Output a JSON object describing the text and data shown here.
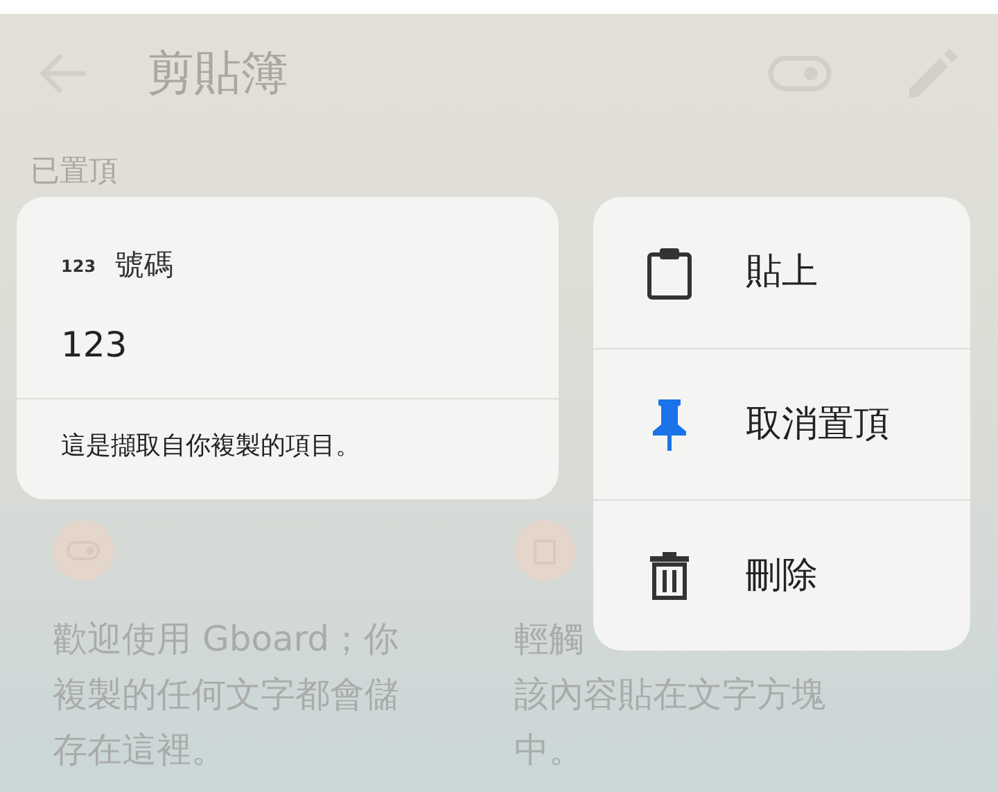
{
  "header": {
    "title": "剪貼簿"
  },
  "pinned_label": "已置頂",
  "tips": [
    {
      "kind": "toggle",
      "text": "歡迎使用 Gboard；你複製的任何文字都會儲存在這裡。"
    },
    {
      "kind": "clipboard",
      "covered_line": "輕觸",
      "text": "該內容貼在文字方塊中。"
    }
  ],
  "popup_card": {
    "type_icon": "123",
    "type_label": "號碼",
    "value": "123",
    "description": "這是擷取自你複製的項目。"
  },
  "menu": [
    {
      "kind": "paste",
      "label": "貼上"
    },
    {
      "kind": "unpin",
      "label": "取消置頂"
    },
    {
      "kind": "delete",
      "label": "刪除"
    }
  ]
}
